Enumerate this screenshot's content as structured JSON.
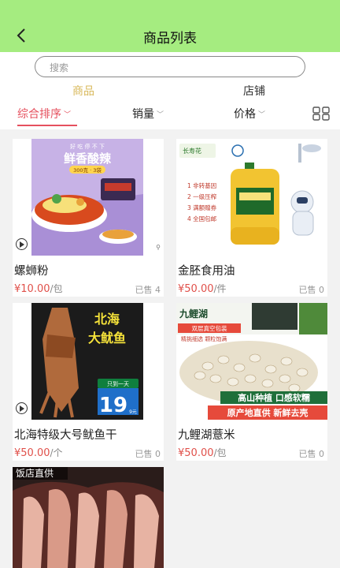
{
  "header": {
    "title": "商品列表"
  },
  "search": {
    "placeholder": "搜索"
  },
  "segments": {
    "products": "商品",
    "shops": "店铺"
  },
  "filters": {
    "comprehensive": "综合排序",
    "sales": "销量",
    "price": "价格"
  },
  "colors": {
    "header_bg": "#a5ec80",
    "accent_red": "#e5505e",
    "segment_active": "#d8b85a",
    "price": "#e0504a"
  },
  "products": [
    {
      "name": "螺蛳粉",
      "price": "¥10.00",
      "unit": "/包",
      "sold": "已售 4",
      "img": {
        "line1": "好 吃 停 不 下",
        "line2": "鲜香酸辣",
        "line3": "300克 · 3袋"
      }
    },
    {
      "name": "金胚食用油",
      "price": "¥50.00",
      "unit": "/件",
      "sold": "已售 0",
      "img": {
        "brand": "长寿花",
        "feat1": "1 非转基因",
        "feat2": "2 一级压榨",
        "feat3": "3 满额赠券",
        "feat4": "4 全国包邮"
      }
    },
    {
      "name": "北海特级大号鱿鱼干",
      "price": "¥50.00",
      "unit": "/个",
      "sold": "已售 0",
      "img": {
        "line1": "北海",
        "line2": "大鱿鱼",
        "tag": "只到一天",
        "num": "19",
        "small": "9元"
      }
    },
    {
      "name": "九鲤湖薏米",
      "price": "¥50.00",
      "unit": "/包",
      "sold": "已售 0",
      "img": {
        "brand": "九鲤湖",
        "tag1": "双层真空包装",
        "tag2": "精挑细选 颗粒饱满",
        "banner1": "高山种植 口感软糯",
        "banner2": "原产地直供 新鲜去壳"
      }
    },
    {
      "img": {
        "tag": "饭店直供"
      }
    }
  ]
}
